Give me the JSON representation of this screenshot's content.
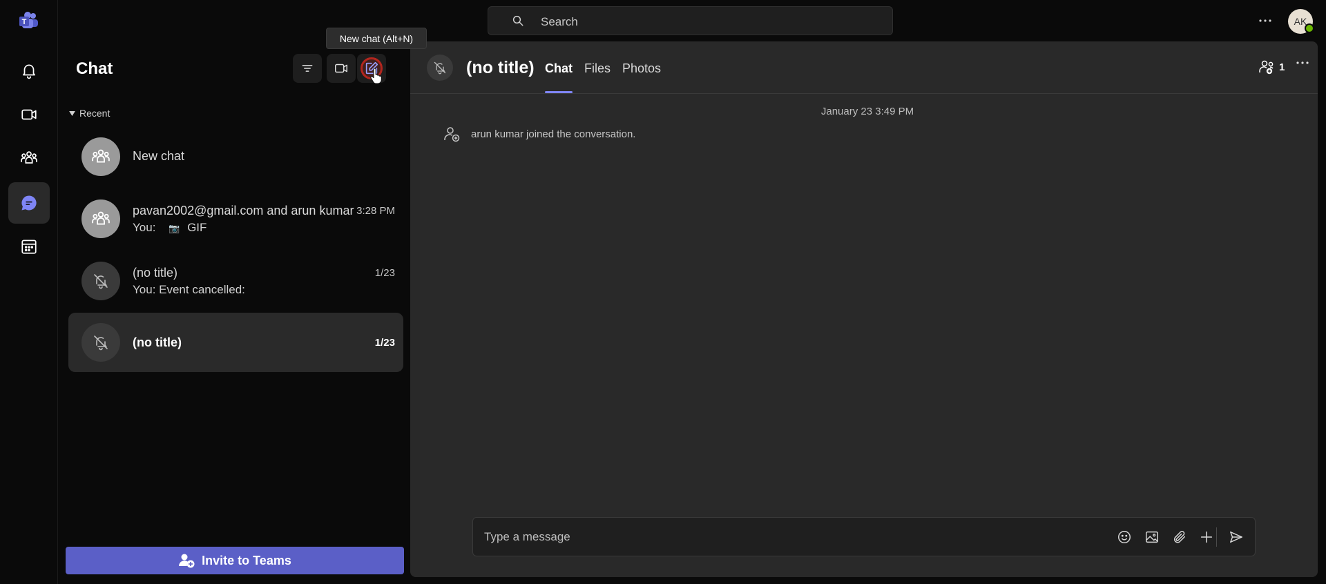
{
  "colors": {
    "accent": "#5b5fc7",
    "tab_underline": "#7f85f5",
    "presence_available": "#6bb700",
    "cursor_highlight": "#b3261e"
  },
  "rail": {
    "logo_icon": "teams-logo-icon",
    "items": [
      {
        "icon": "bell-icon",
        "name": "activity"
      },
      {
        "icon": "video-camera-icon",
        "name": "meet"
      },
      {
        "icon": "people-icon",
        "name": "communities"
      },
      {
        "icon": "chat-bubble-icon",
        "name": "chat",
        "active": true
      },
      {
        "icon": "calendar-icon",
        "name": "calendar"
      }
    ]
  },
  "top_bar": {
    "search_placeholder": "Search",
    "more_icon": "ellipsis-icon",
    "avatar_initials": "AK"
  },
  "chat_panel": {
    "title": "Chat",
    "tools": {
      "filter_icon": "filter-icon",
      "meet_icon": "video-camera-icon",
      "new_chat_icon": "compose-icon"
    },
    "tooltip": "New chat (Alt+N)",
    "section_label": "Recent",
    "items": [
      {
        "name": "New chat",
        "preview": "",
        "time": "",
        "avatar": "group",
        "selected": false
      },
      {
        "name": "pavan2002@gmail.com and arun kumar",
        "preview_prefix": "You:",
        "preview_badge": "📷",
        "preview": "GIF",
        "time": "3:28 PM",
        "avatar": "group",
        "selected": false
      },
      {
        "name": "(no title)",
        "preview": "You: Event cancelled:",
        "time": "1/23",
        "avatar": "muted",
        "selected": false
      },
      {
        "name": "(no title)",
        "preview": "",
        "time": "1/23",
        "avatar": "muted",
        "selected": true
      }
    ],
    "invite_label": "Invite to Teams"
  },
  "conversation": {
    "title": "(no title)",
    "tabs": [
      {
        "label": "Chat",
        "active": true
      },
      {
        "label": "Files",
        "active": false
      },
      {
        "label": "Photos",
        "active": false
      }
    ],
    "participant_count": "1",
    "timestamp": "January 23 3:49 PM",
    "system_message": "arun kumar joined the conversation.",
    "compose_placeholder": "Type a message"
  }
}
